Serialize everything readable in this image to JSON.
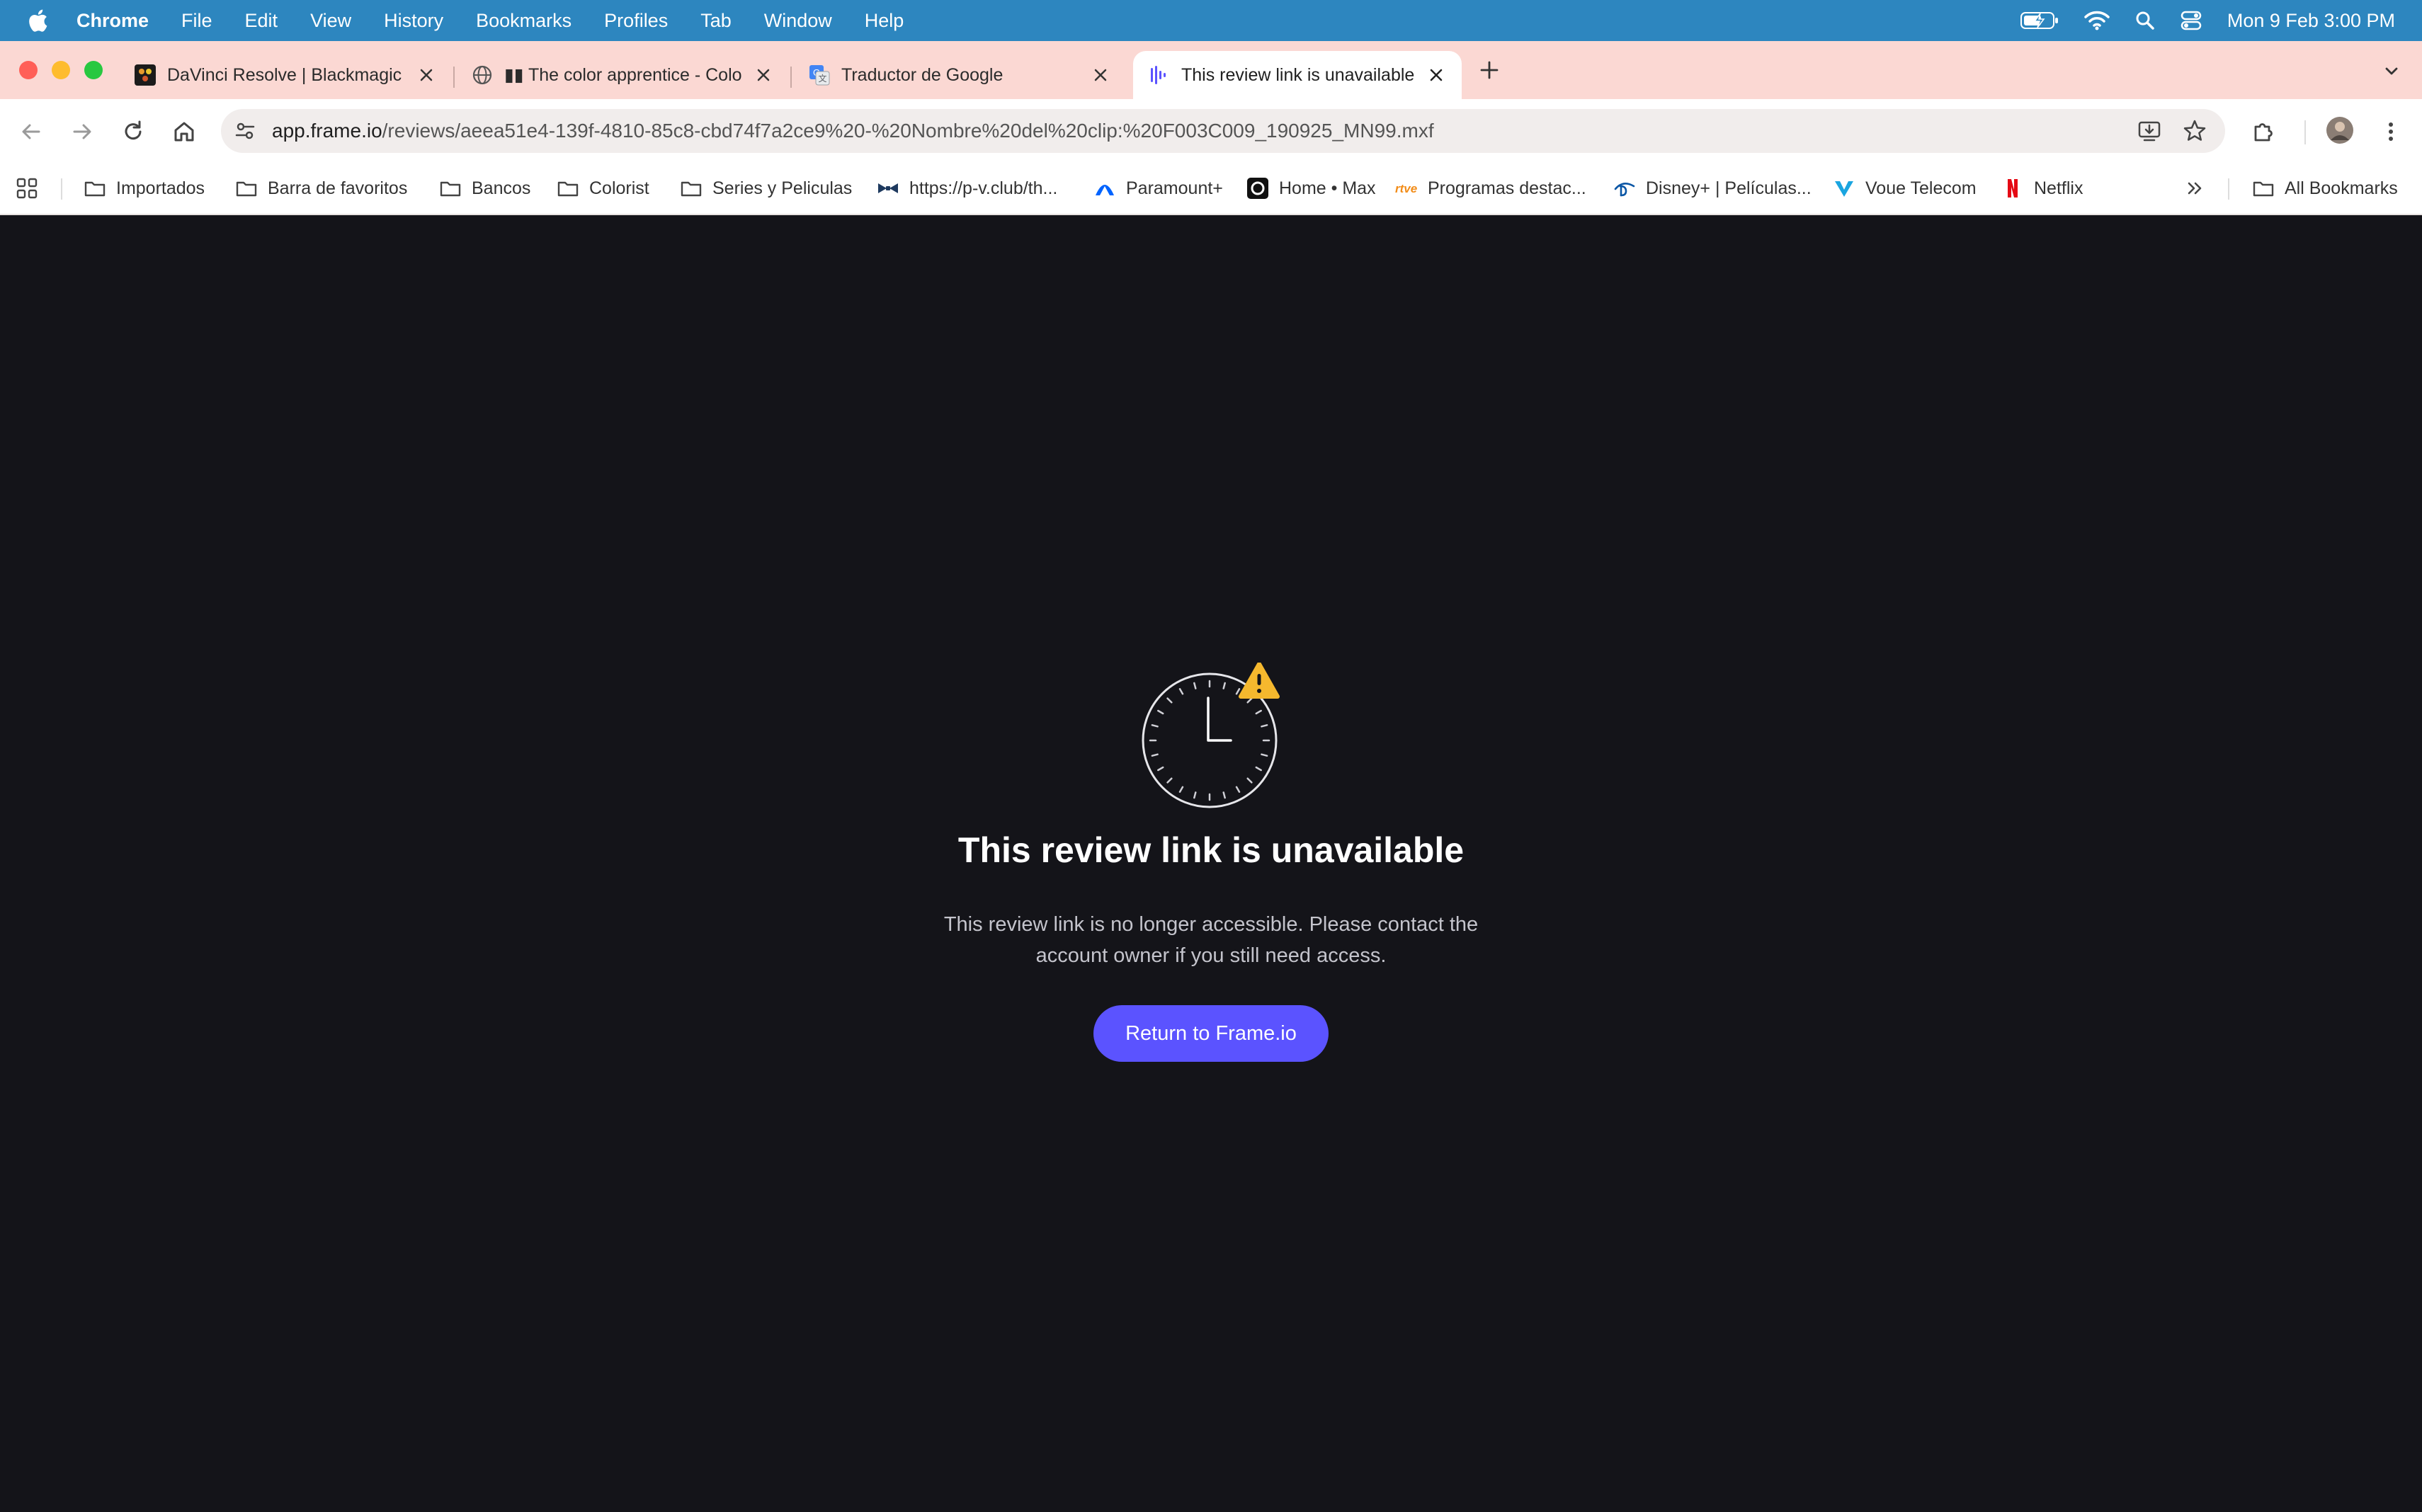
{
  "menubar": {
    "app_name": "Chrome",
    "menus": [
      "File",
      "Edit",
      "View",
      "History",
      "Bookmarks",
      "Profiles",
      "Tab",
      "Window",
      "Help"
    ],
    "clock": "Mon 9 Feb  3:00 PM"
  },
  "tabs": [
    {
      "title": "DaVinci Resolve | Blackmagic",
      "icon": "davinci-icon",
      "active": false
    },
    {
      "title": "▮▮ The color apprentice - Colo",
      "icon": "globe-icon",
      "active": false
    },
    {
      "title": "Traductor de Google",
      "icon": "google-translate-icon",
      "active": false
    },
    {
      "title": "This review link is unavailable",
      "icon": "frameio-icon",
      "active": true
    }
  ],
  "address_bar": {
    "host": "app.frame.io",
    "path": "/reviews/aeea51e4-139f-4810-85c8-cbd74f7a2ce9%20-%20Nombre%20del%20clip:%20F003C009_190925_MN99.mxf"
  },
  "bookmarks": [
    {
      "label": "Importados",
      "icon": "folder-icon"
    },
    {
      "label": "Barra de favoritos",
      "icon": "folder-icon"
    },
    {
      "label": "Bancos",
      "icon": "folder-icon"
    },
    {
      "label": "Colorist",
      "icon": "folder-icon"
    },
    {
      "label": "Series y Peliculas",
      "icon": "folder-icon"
    },
    {
      "label": "https://p-v.club/th...",
      "icon": "bowtie-icon"
    },
    {
      "label": "Paramount+",
      "icon": "paramount-icon"
    },
    {
      "label": "Home • Max",
      "icon": "max-icon"
    },
    {
      "label": "Programas destac...",
      "icon": "rtve-icon"
    },
    {
      "label": "Disney+ | Películas...",
      "icon": "disney-icon"
    },
    {
      "label": "Voue Telecom",
      "icon": "voue-icon"
    },
    {
      "label": "Netflix",
      "icon": "netflix-icon"
    }
  ],
  "all_bookmarks_label": "All Bookmarks",
  "page": {
    "title": "This review link is unavailable",
    "description": "This review link is no longer accessible. Please contact the account owner if you still need access.",
    "button_label": "Return to Frame.io"
  },
  "colors": {
    "menubar": "#2d86bf",
    "tabstrip": "#fbd8d3",
    "content_bg": "#141419",
    "button": "#5b53ff",
    "warning": "#f5b82e"
  }
}
